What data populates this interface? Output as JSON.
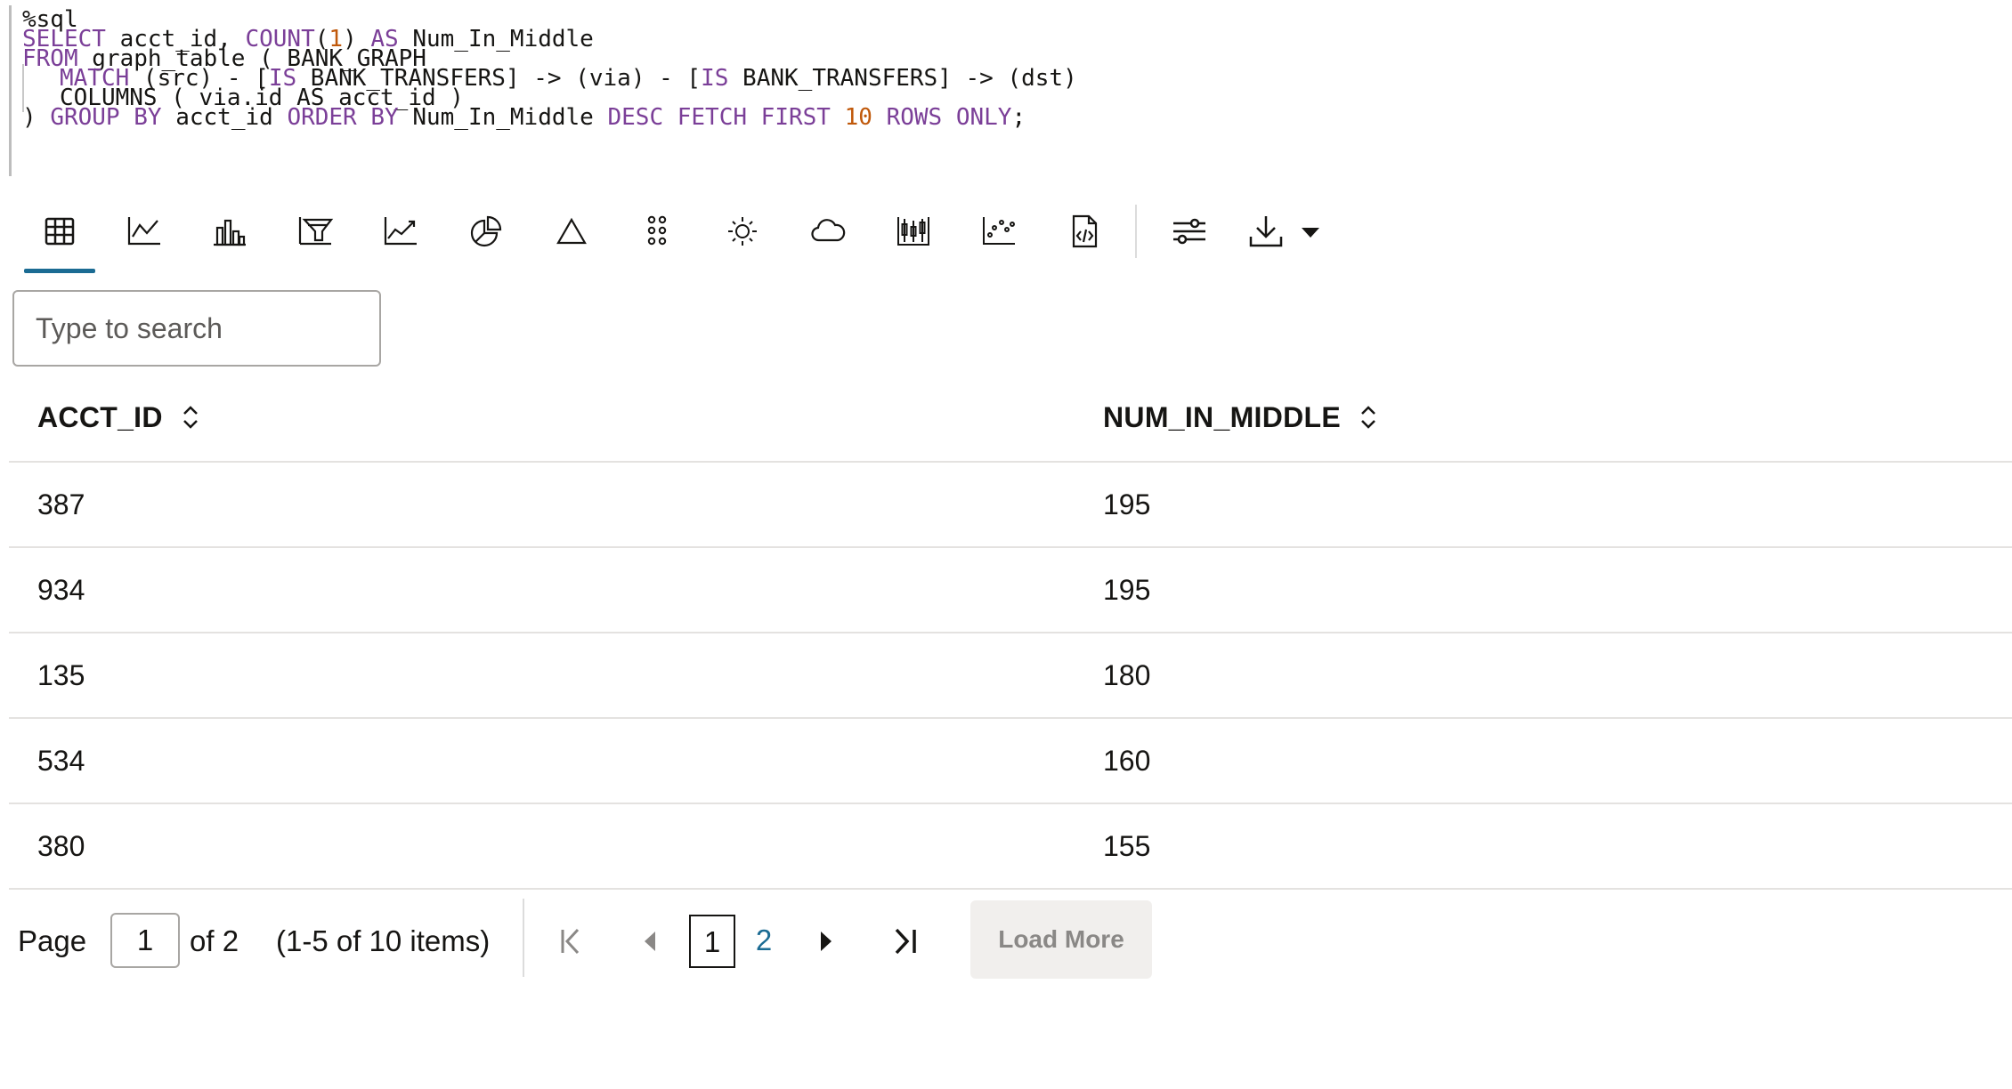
{
  "code": {
    "magic": "%sql",
    "line1": {
      "kw1": "SELECT",
      "t1": " acct_id, ",
      "fn": "COUNT",
      "p1": "(",
      "n1": "1",
      "p2": ") ",
      "kw2": "AS",
      "t2": " Num_In_Middle"
    },
    "line2": {
      "kw1": "FROM",
      "t1": " graph_table ( BANK_GRAPH"
    },
    "line3": {
      "kw1": "MATCH",
      "t1": " (src) - [",
      "kw2": "IS",
      "t2": " BANK_TRANSFERS] -> (via) - [",
      "kw3": "IS",
      "t3": " BANK_TRANSFERS] -> (dst)"
    },
    "line4": {
      "t1": "COLUMNS ( via.id AS acct_id )"
    },
    "line5": {
      "t1": ") ",
      "kw1": "GROUP BY",
      "t2": " acct_id ",
      "kw2": "ORDER BY",
      "t3": " Num_In_Middle ",
      "kw3": "DESC FETCH FIRST",
      "t4": " ",
      "n1": "10",
      "t5": " ",
      "kw4": "ROWS ONLY",
      "t6": ";"
    }
  },
  "toolbar": {
    "active": "table-icon",
    "icons": [
      "table-icon",
      "line-chart-icon",
      "bar-chart-icon",
      "funnel-chart-icon",
      "area-chart-icon",
      "pie-chart-icon",
      "pyramid-icon",
      "dot-grid-icon",
      "sunburst-icon",
      "word-cloud-icon",
      "boxplot-icon",
      "scatter-icon",
      "code-file-icon",
      "settings-sliders-icon",
      "download-icon"
    ]
  },
  "search": {
    "placeholder": "Type to search",
    "value": ""
  },
  "table": {
    "columns": [
      "ACCT_ID",
      "NUM_IN_MIDDLE"
    ],
    "rows": [
      [
        "387",
        "195"
      ],
      [
        "934",
        "195"
      ],
      [
        "135",
        "180"
      ],
      [
        "534",
        "160"
      ],
      [
        "380",
        "155"
      ]
    ]
  },
  "pagination": {
    "page_label": "Page",
    "current_page": "1",
    "of_label": "of 2",
    "items_label": "(1-5 of 10 items)",
    "pages": [
      "1",
      "2"
    ],
    "load_more": "Load More"
  },
  "colors": {
    "accent": "#1b6b93",
    "keyword": "#7b3f98",
    "number": "#c0590b"
  }
}
